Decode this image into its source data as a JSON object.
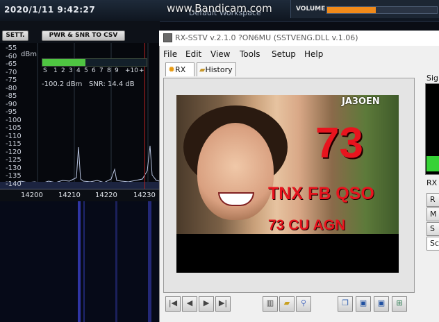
{
  "topbar": {
    "datetime": "2020/1/11 9:42:27",
    "watermark": "www.Bandicam.com",
    "workspace": "Default Workspace",
    "volume_label": "VOLUME",
    "volume_level": 0.45
  },
  "sdr": {
    "settings_button": "SETT.",
    "pwr_button": "PWR & SNR TO CSV",
    "db_unit": "dBm",
    "db_ticks": [
      "-55",
      "-60",
      "-65",
      "-70",
      "-75",
      "-80",
      "-85",
      "-90",
      "-95",
      "-100",
      "-105",
      "-110",
      "-115",
      "-120",
      "-125",
      "-130",
      "-135",
      "-140"
    ],
    "s_scale": [
      "S",
      "1",
      "2",
      "3",
      "4",
      "5",
      "6",
      "7",
      "8",
      "9",
      "+10",
      "+"
    ],
    "s_level": 0.42,
    "dbm_reading": "-100.2 dBm",
    "snr_reading": "SNR: 14.4 dB",
    "freq_ticks": [
      "14200",
      "14210",
      "14220",
      "14230"
    ]
  },
  "window": {
    "title": "RX-SSTV v.2.1.0 ?ON6MU (SSTVENG.DLL v.1.06)",
    "menu": [
      "File",
      "Edit",
      "View",
      "Tools",
      "Setup",
      "Help"
    ],
    "tabs": [
      "RX",
      "History"
    ],
    "image_text": {
      "callsign": "JA3OEN",
      "big": "73",
      "line1": "TNX FB QSO",
      "line2": "73 CU AGN"
    },
    "signal_label": "Sig",
    "rx_label": "RX",
    "right_buttons": [
      "R",
      "M",
      "S",
      "Sc"
    ]
  },
  "colors": {
    "volume": "#f08a1a",
    "smeter": "#4fc542",
    "signal": "#36d236",
    "image_text": "#e8141e"
  }
}
